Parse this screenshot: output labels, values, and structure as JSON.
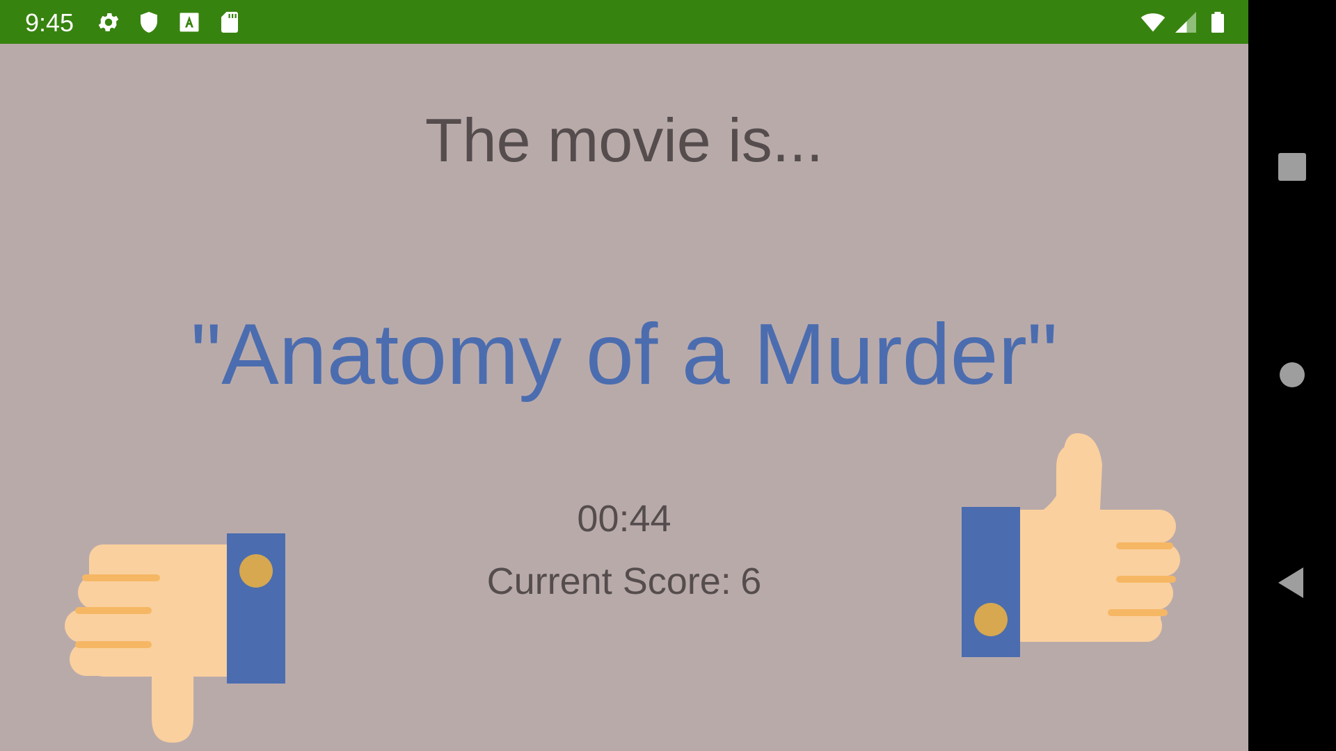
{
  "status_bar": {
    "time": "9:45",
    "background_color": "#37830f",
    "icons_left": [
      "gear-icon",
      "shield-icon",
      "a-box-icon",
      "sd-card-icon"
    ],
    "icons_right": [
      "wifi-icon",
      "cell-signal-icon",
      "battery-icon"
    ]
  },
  "game": {
    "headline": "The movie is...",
    "movie_title": "\"Anatomy of a Murder\"",
    "timer": "00:44",
    "score_label": "Current Score:",
    "score_value": "6",
    "thumb_down_label": "thumbs-down",
    "thumb_up_label": "thumbs-up"
  },
  "colors": {
    "background": "#b9aaaa",
    "headline_text": "#554d4d",
    "title_text": "#4b6daf",
    "skin": "#fad09e",
    "sleeve": "#4b6daf",
    "button": "#d7a84f"
  },
  "nav_bar": {
    "buttons": [
      "recents-square-icon",
      "home-circle-icon",
      "back-triangle-icon"
    ]
  }
}
